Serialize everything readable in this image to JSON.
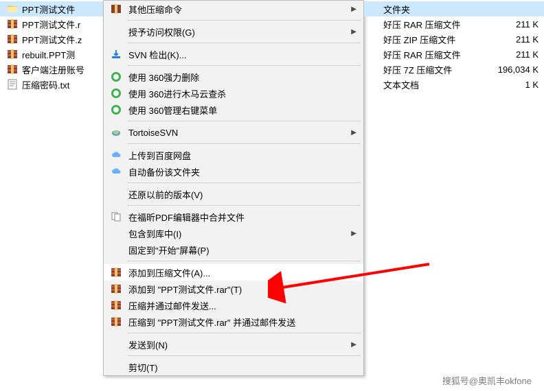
{
  "files": [
    {
      "name": "PPT测试文件",
      "icon": "folder",
      "selected": true
    },
    {
      "name": "PPT测试文件.r",
      "icon": "archive",
      "selected": false
    },
    {
      "name": "PPT测试文件.z",
      "icon": "archive",
      "selected": false
    },
    {
      "name": "rebuilt.PPT测",
      "icon": "archive",
      "selected": false
    },
    {
      "name": "客户端注册账号",
      "icon": "archive",
      "selected": false
    },
    {
      "name": "压缩密码.txt",
      "icon": "txt",
      "selected": false
    }
  ],
  "menu": {
    "other_compress": "其他压缩命令",
    "access": "授予访问权限(G)",
    "svn_checkout": "SVN 检出(K)...",
    "force_delete": "使用 360强力删除",
    "trojan_scan": "使用 360进行木马云查杀",
    "manage_menu": "使用 360管理右键菜单",
    "tortoise": "TortoiseSVN",
    "upload_baidu": "上传到百度网盘",
    "auto_backup": "自动备份该文件夹",
    "restore": "还原以前的版本(V)",
    "merge_pdf": "在福昕PDF编辑器中合并文件",
    "include_lib": "包含到库中(I)",
    "pin_start": "固定到\"开始\"屏幕(P)",
    "add_archive": "添加到压缩文件(A)...",
    "add_to_rar": "添加到 \"PPT测试文件.rar\"(T)",
    "compress_email": "压缩并通过邮件发送...",
    "compress_to_rar_email": "压缩到 \"PPT测试文件.rar\" 并通过邮件发送",
    "send_to": "发送到(N)",
    "cut": "剪切(T)"
  },
  "details": [
    {
      "type": "文件夹",
      "size": "",
      "selected": true
    },
    {
      "type": "好压 RAR 压缩文件",
      "size": "211 K",
      "selected": false
    },
    {
      "type": "好压 ZIP 压缩文件",
      "size": "211 K",
      "selected": false
    },
    {
      "type": "好压 RAR 压缩文件",
      "size": "211 K",
      "selected": false
    },
    {
      "type": "好压 7Z 压缩文件",
      "size": "196,034 K",
      "selected": false
    },
    {
      "type": "文本文档",
      "size": "1 K",
      "selected": false
    }
  ],
  "watermark": "搜狐号@奥凯丰okfone"
}
